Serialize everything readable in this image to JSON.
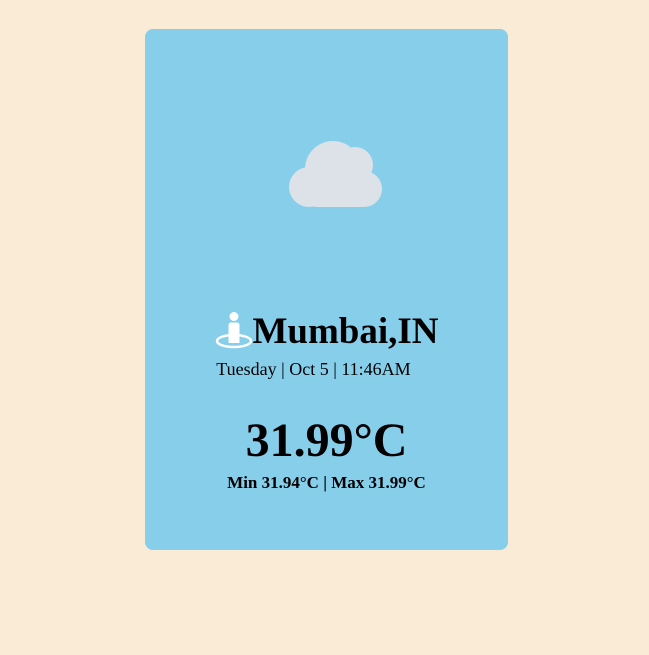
{
  "weather": {
    "condition_icon": "cloud-icon",
    "location_icon": "location-person-icon",
    "city": "Mumbai,IN",
    "datetime": "Tuesday | Oct 5 | 11:46AM",
    "temperature": "31.99°C",
    "minmax": "Min 31.94°C | Max 31.99°C"
  },
  "colors": {
    "page_background": "#faebd7",
    "card_background": "#87ceeb",
    "cloud_fill": "#dde1e8",
    "icon_white": "#ffffff"
  }
}
